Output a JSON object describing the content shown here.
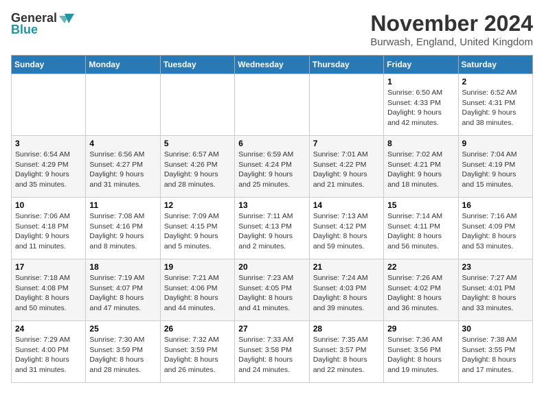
{
  "header": {
    "logo_line1": "General",
    "logo_line2": "Blue",
    "main_title": "November 2024",
    "subtitle": "Burwash, England, United Kingdom"
  },
  "calendar": {
    "days_of_week": [
      "Sunday",
      "Monday",
      "Tuesday",
      "Wednesday",
      "Thursday",
      "Friday",
      "Saturday"
    ],
    "weeks": [
      [
        {
          "day": "",
          "info": ""
        },
        {
          "day": "",
          "info": ""
        },
        {
          "day": "",
          "info": ""
        },
        {
          "day": "",
          "info": ""
        },
        {
          "day": "",
          "info": ""
        },
        {
          "day": "1",
          "info": "Sunrise: 6:50 AM\nSunset: 4:33 PM\nDaylight: 9 hours\nand 42 minutes."
        },
        {
          "day": "2",
          "info": "Sunrise: 6:52 AM\nSunset: 4:31 PM\nDaylight: 9 hours\nand 38 minutes."
        }
      ],
      [
        {
          "day": "3",
          "info": "Sunrise: 6:54 AM\nSunset: 4:29 PM\nDaylight: 9 hours\nand 35 minutes."
        },
        {
          "day": "4",
          "info": "Sunrise: 6:56 AM\nSunset: 4:27 PM\nDaylight: 9 hours\nand 31 minutes."
        },
        {
          "day": "5",
          "info": "Sunrise: 6:57 AM\nSunset: 4:26 PM\nDaylight: 9 hours\nand 28 minutes."
        },
        {
          "day": "6",
          "info": "Sunrise: 6:59 AM\nSunset: 4:24 PM\nDaylight: 9 hours\nand 25 minutes."
        },
        {
          "day": "7",
          "info": "Sunrise: 7:01 AM\nSunset: 4:22 PM\nDaylight: 9 hours\nand 21 minutes."
        },
        {
          "day": "8",
          "info": "Sunrise: 7:02 AM\nSunset: 4:21 PM\nDaylight: 9 hours\nand 18 minutes."
        },
        {
          "day": "9",
          "info": "Sunrise: 7:04 AM\nSunset: 4:19 PM\nDaylight: 9 hours\nand 15 minutes."
        }
      ],
      [
        {
          "day": "10",
          "info": "Sunrise: 7:06 AM\nSunset: 4:18 PM\nDaylight: 9 hours\nand 11 minutes."
        },
        {
          "day": "11",
          "info": "Sunrise: 7:08 AM\nSunset: 4:16 PM\nDaylight: 9 hours\nand 8 minutes."
        },
        {
          "day": "12",
          "info": "Sunrise: 7:09 AM\nSunset: 4:15 PM\nDaylight: 9 hours\nand 5 minutes."
        },
        {
          "day": "13",
          "info": "Sunrise: 7:11 AM\nSunset: 4:13 PM\nDaylight: 9 hours\nand 2 minutes."
        },
        {
          "day": "14",
          "info": "Sunrise: 7:13 AM\nSunset: 4:12 PM\nDaylight: 8 hours\nand 59 minutes."
        },
        {
          "day": "15",
          "info": "Sunrise: 7:14 AM\nSunset: 4:11 PM\nDaylight: 8 hours\nand 56 minutes."
        },
        {
          "day": "16",
          "info": "Sunrise: 7:16 AM\nSunset: 4:09 PM\nDaylight: 8 hours\nand 53 minutes."
        }
      ],
      [
        {
          "day": "17",
          "info": "Sunrise: 7:18 AM\nSunset: 4:08 PM\nDaylight: 8 hours\nand 50 minutes."
        },
        {
          "day": "18",
          "info": "Sunrise: 7:19 AM\nSunset: 4:07 PM\nDaylight: 8 hours\nand 47 minutes."
        },
        {
          "day": "19",
          "info": "Sunrise: 7:21 AM\nSunset: 4:06 PM\nDaylight: 8 hours\nand 44 minutes."
        },
        {
          "day": "20",
          "info": "Sunrise: 7:23 AM\nSunset: 4:05 PM\nDaylight: 8 hours\nand 41 minutes."
        },
        {
          "day": "21",
          "info": "Sunrise: 7:24 AM\nSunset: 4:03 PM\nDaylight: 8 hours\nand 39 minutes."
        },
        {
          "day": "22",
          "info": "Sunrise: 7:26 AM\nSunset: 4:02 PM\nDaylight: 8 hours\nand 36 minutes."
        },
        {
          "day": "23",
          "info": "Sunrise: 7:27 AM\nSunset: 4:01 PM\nDaylight: 8 hours\nand 33 minutes."
        }
      ],
      [
        {
          "day": "24",
          "info": "Sunrise: 7:29 AM\nSunset: 4:00 PM\nDaylight: 8 hours\nand 31 minutes."
        },
        {
          "day": "25",
          "info": "Sunrise: 7:30 AM\nSunset: 3:59 PM\nDaylight: 8 hours\nand 28 minutes."
        },
        {
          "day": "26",
          "info": "Sunrise: 7:32 AM\nSunset: 3:59 PM\nDaylight: 8 hours\nand 26 minutes."
        },
        {
          "day": "27",
          "info": "Sunrise: 7:33 AM\nSunset: 3:58 PM\nDaylight: 8 hours\nand 24 minutes."
        },
        {
          "day": "28",
          "info": "Sunrise: 7:35 AM\nSunset: 3:57 PM\nDaylight: 8 hours\nand 22 minutes."
        },
        {
          "day": "29",
          "info": "Sunrise: 7:36 AM\nSunset: 3:56 PM\nDaylight: 8 hours\nand 19 minutes."
        },
        {
          "day": "30",
          "info": "Sunrise: 7:38 AM\nSunset: 3:55 PM\nDaylight: 8 hours\nand 17 minutes."
        }
      ]
    ]
  }
}
